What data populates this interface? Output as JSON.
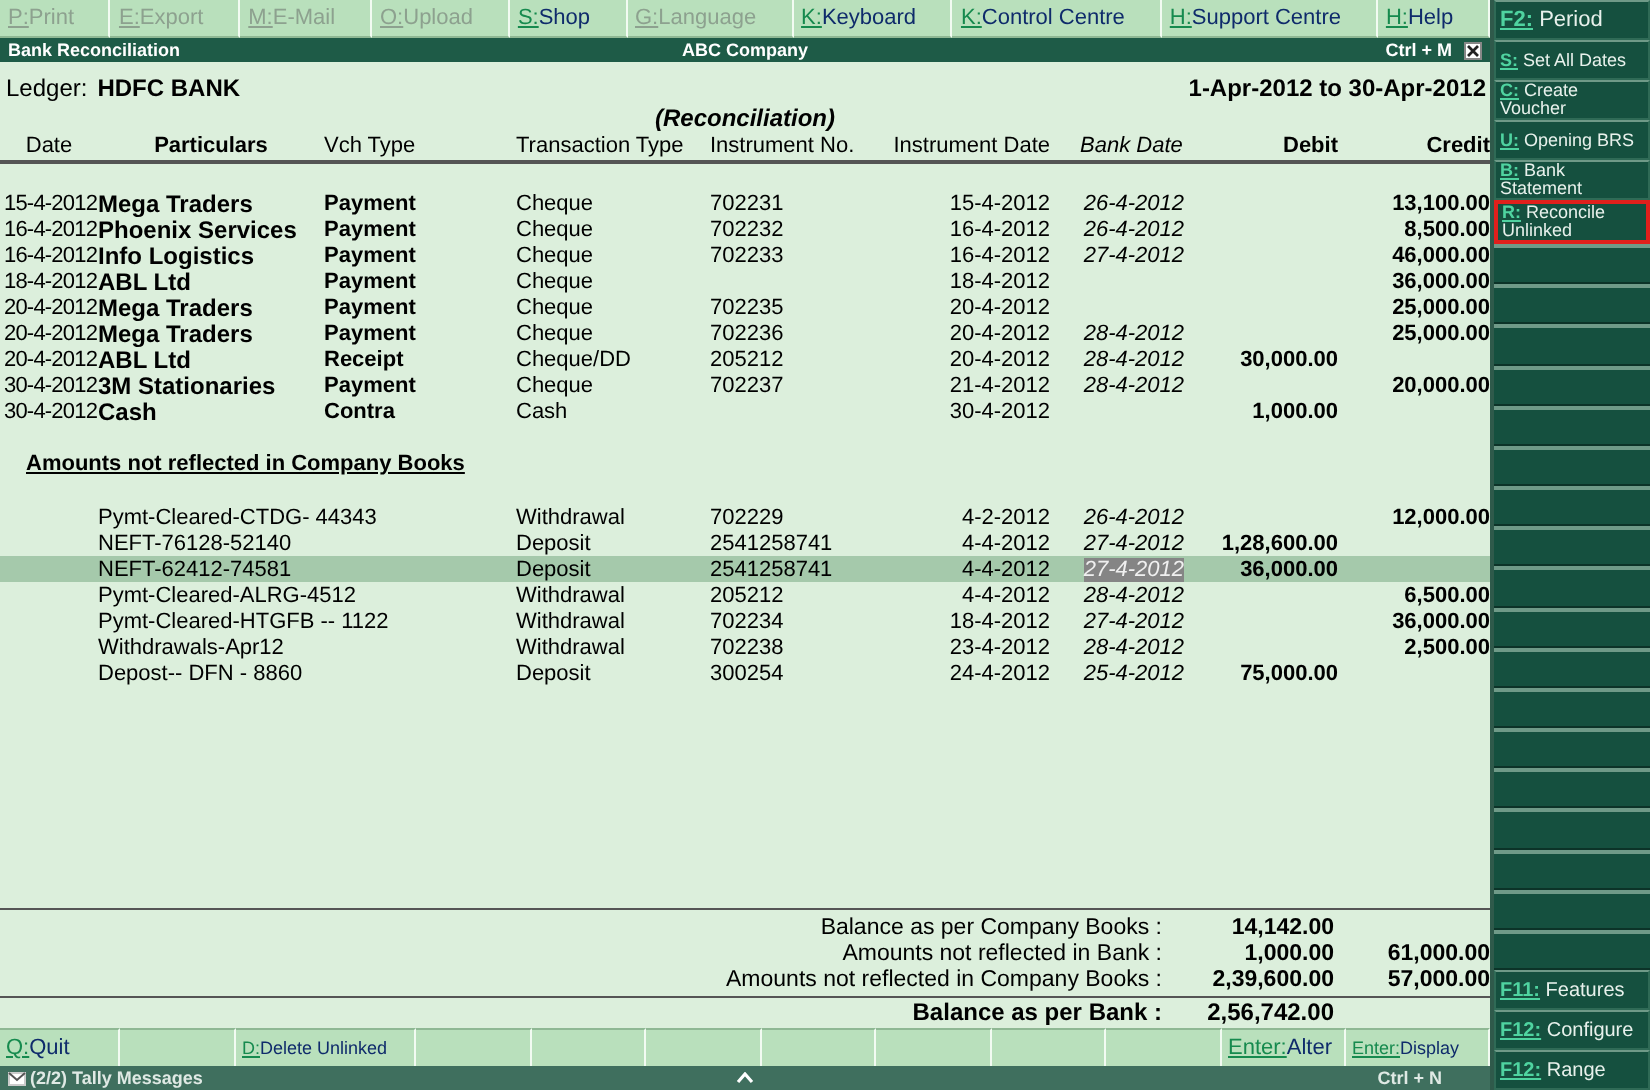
{
  "toolbar": [
    {
      "key": "P:",
      "label": "Print",
      "disabled": true
    },
    {
      "key": "E:",
      "label": "Export",
      "disabled": true
    },
    {
      "key": "M:",
      "label": "E-Mail",
      "disabled": true
    },
    {
      "key": "O:",
      "label": "Upload",
      "disabled": true
    },
    {
      "key": "S:",
      "label": "Shop",
      "disabled": false
    },
    {
      "key": "G:",
      "label": "Language",
      "disabled": true
    },
    {
      "key": "K:",
      "label": "Keyboard",
      "disabled": false
    },
    {
      "key": "K:",
      "label": "Control Centre",
      "disabled": false
    },
    {
      "key": "H:",
      "label": "Support Centre",
      "disabled": false
    },
    {
      "key": "H:",
      "label": "Help",
      "disabled": false
    }
  ],
  "window": {
    "title": "Bank Reconciliation",
    "company": "ABC Company",
    "shortcut": "Ctrl + M"
  },
  "ledger": {
    "label": "Ledger:",
    "name": "HDFC BANK",
    "period": "1-Apr-2012 to 30-Apr-2012",
    "subtitle": "(Reconciliation)"
  },
  "table": {
    "columns": [
      "Date",
      "Particulars",
      "Vch Type",
      "Transaction Type",
      "Instrument No.",
      "Instrument Date",
      "Bank Date",
      "Debit",
      "Credit"
    ],
    "rows": [
      {
        "date": "15-4-2012",
        "particulars": "Mega Traders",
        "vch_type": "Payment",
        "transaction_type": "Cheque",
        "instrument_no": "702231",
        "instrument_date": "15-4-2012",
        "bank_date": "26-4-2012",
        "credit": "13,100.00"
      },
      {
        "date": "16-4-2012",
        "particulars": "Phoenix Services",
        "vch_type": "Payment",
        "transaction_type": "Cheque",
        "instrument_no": "702232",
        "instrument_date": "16-4-2012",
        "bank_date": "26-4-2012",
        "credit": "8,500.00"
      },
      {
        "date": "16-4-2012",
        "particulars": "Info Logistics",
        "vch_type": "Payment",
        "transaction_type": "Cheque",
        "instrument_no": "702233",
        "instrument_date": "16-4-2012",
        "bank_date": "27-4-2012",
        "credit": "46,000.00"
      },
      {
        "date": "18-4-2012",
        "particulars": "ABL Ltd",
        "vch_type": "Payment",
        "transaction_type": "Cheque",
        "instrument_date": "18-4-2012",
        "credit": "36,000.00"
      },
      {
        "date": "20-4-2012",
        "particulars": "Mega Traders",
        "vch_type": "Payment",
        "transaction_type": "Cheque",
        "instrument_no": "702235",
        "instrument_date": "20-4-2012",
        "credit": "25,000.00"
      },
      {
        "date": "20-4-2012",
        "particulars": "Mega Traders",
        "vch_type": "Payment",
        "transaction_type": "Cheque",
        "instrument_no": "702236",
        "instrument_date": "20-4-2012",
        "bank_date": "28-4-2012",
        "credit": "25,000.00"
      },
      {
        "date": "20-4-2012",
        "particulars": "ABL Ltd",
        "vch_type": "Receipt",
        "transaction_type": "Cheque/DD",
        "instrument_no": "205212",
        "instrument_date": "20-4-2012",
        "bank_date": "28-4-2012",
        "debit": "30,000.00"
      },
      {
        "date": "30-4-2012",
        "particulars": "3M Stationaries",
        "vch_type": "Payment",
        "transaction_type": "Cheque",
        "instrument_no": "702237",
        "instrument_date": "21-4-2012",
        "bank_date": "28-4-2012",
        "credit": "20,000.00"
      },
      {
        "date": "30-4-2012",
        "particulars": "Cash",
        "vch_type": "Contra",
        "transaction_type": "Cash",
        "instrument_date": "30-4-2012",
        "debit": "1,000.00"
      }
    ]
  },
  "bank_section": {
    "title": "Amounts not reflected in Company Books",
    "rows": [
      {
        "particulars": "Pymt-Cleared-CTDG- 44343",
        "transaction_type": "Withdrawal",
        "instrument_no": "702229",
        "instrument_date": "4-2-2012",
        "bank_date": "26-4-2012",
        "credit": "12,000.00",
        "selected": false
      },
      {
        "particulars": "NEFT-76128-52140",
        "transaction_type": "Deposit",
        "instrument_no": "2541258741",
        "instrument_date": "4-4-2012",
        "bank_date": "27-4-2012",
        "debit": "1,28,600.00",
        "selected": false
      },
      {
        "particulars": "NEFT-62412-74581",
        "transaction_type": "Deposit",
        "instrument_no": "2541258741",
        "instrument_date": "4-4-2012",
        "bank_date": "27-4-2012",
        "debit": "36,000.00",
        "selected": true
      },
      {
        "particulars": "Pymt-Cleared-ALRG-4512",
        "transaction_type": "Withdrawal",
        "instrument_no": "205212",
        "instrument_date": "4-4-2012",
        "bank_date": "28-4-2012",
        "credit": "6,500.00",
        "selected": false
      },
      {
        "particulars": "Pymt-Cleared-HTGFB -- 1122",
        "transaction_type": "Withdrawal",
        "instrument_no": "702234",
        "instrument_date": "18-4-2012",
        "bank_date": "27-4-2012",
        "credit": "36,000.00",
        "selected": false
      },
      {
        "particulars": "Withdrawals-Apr12",
        "transaction_type": "Withdrawal",
        "instrument_no": "702238",
        "instrument_date": "23-4-2012",
        "bank_date": "28-4-2012",
        "credit": "2,500.00",
        "selected": false
      },
      {
        "particulars": "Depost-- DFN - 8860",
        "transaction_type": "Deposit",
        "instrument_no": "300254",
        "instrument_date": "24-4-2012",
        "bank_date": "25-4-2012",
        "debit": "75,000.00",
        "selected": false
      }
    ]
  },
  "totals": [
    {
      "kind": "line",
      "label": "Balance as per Company Books :",
      "debit": "14,142.00"
    },
    {
      "kind": "line",
      "label": "Amounts not reflected in Bank :",
      "debit": "1,000.00",
      "credit": "61,000.00"
    },
    {
      "kind": "line",
      "label": "Amounts not reflected in Company Books :",
      "debit": "2,39,600.00",
      "credit": "57,000.00"
    },
    {
      "kind": "total",
      "label": "Balance as per Bank :",
      "debit": "2,56,742.00"
    }
  ],
  "bottom_buttons": [
    {
      "key": "Q:",
      "label": "Quit"
    },
    {
      "key": "D:",
      "label": "Delete Unlinked"
    },
    {
      "key": "Enter:",
      "label": "Alter"
    },
    {
      "key": "Enter:",
      "label": "Display"
    }
  ],
  "side_buttons_top": [
    {
      "key": "F2:",
      "label": "Period",
      "highlighted": false
    },
    {
      "key": "S:",
      "label": "Set All Dates",
      "highlighted": false
    },
    {
      "key": "C:",
      "label": "Create Voucher",
      "highlighted": false
    },
    {
      "key": "U:",
      "label": "Opening BRS",
      "highlighted": false
    },
    {
      "key": "B:",
      "label": "Bank Statement",
      "highlighted": false
    },
    {
      "key": "R:",
      "label": "Reconcile Unlinked",
      "highlighted": true
    }
  ],
  "side_buttons_bottom": [
    {
      "key": "F11:",
      "label": "Features"
    },
    {
      "key": "F12:",
      "label": "Configure"
    },
    {
      "key": "F12:",
      "label": "Range"
    }
  ],
  "status_bar": {
    "messages": "(2/2) Tally Messages",
    "shortcut": "Ctrl + N"
  }
}
